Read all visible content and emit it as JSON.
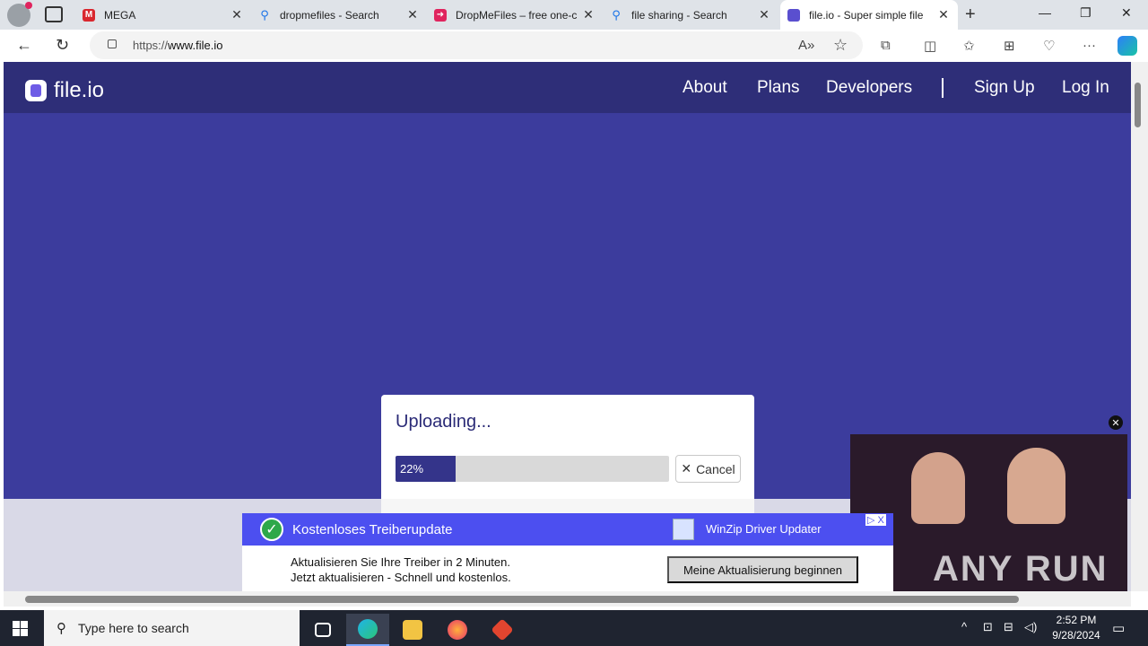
{
  "browser": {
    "tabs": [
      {
        "title": "MEGA",
        "favicon": "mega-icon",
        "color": "#d9272e"
      },
      {
        "title": "dropmefiles - Search",
        "favicon": "search-icon",
        "color": "#1a73e8"
      },
      {
        "title": "DropMeFiles – free one-c",
        "favicon": "dropmefiles-icon",
        "color": "#e0245e"
      },
      {
        "title": "file sharing - Search",
        "favicon": "search-icon",
        "color": "#1a73e8"
      },
      {
        "title": "file.io - Super simple file",
        "favicon": "fileio-icon",
        "color": "#5a4fcf",
        "active": true
      }
    ],
    "url_prefix": "https://",
    "url_host": "www.file.io"
  },
  "site": {
    "logo": "file.io",
    "nav": [
      "About",
      "Plans",
      "Developers",
      "Sign Up",
      "Log In"
    ],
    "bg_color": "#3c3c9d",
    "header_color": "#2e2e78"
  },
  "upload": {
    "title": "Uploading...",
    "progress_label": "22%",
    "progress": 0.22,
    "cancel_label": "Cancel"
  },
  "ad": {
    "title": "Kostenloses Treiberupdate",
    "brand": "WinZip Driver Updater",
    "body_line1": "Aktualisieren Sie Ihre Treiber in 2 Minuten.",
    "body_line2": "Jetzt aktualisieren - Schnell und kostenlos.",
    "cta": "Meine Aktualisierung beginnen",
    "choices": "▷ X"
  },
  "watermark": "ANY RUN",
  "taskbar": {
    "search_placeholder": "Type here to search",
    "time": "2:52 PM",
    "date": "9/28/2024"
  }
}
